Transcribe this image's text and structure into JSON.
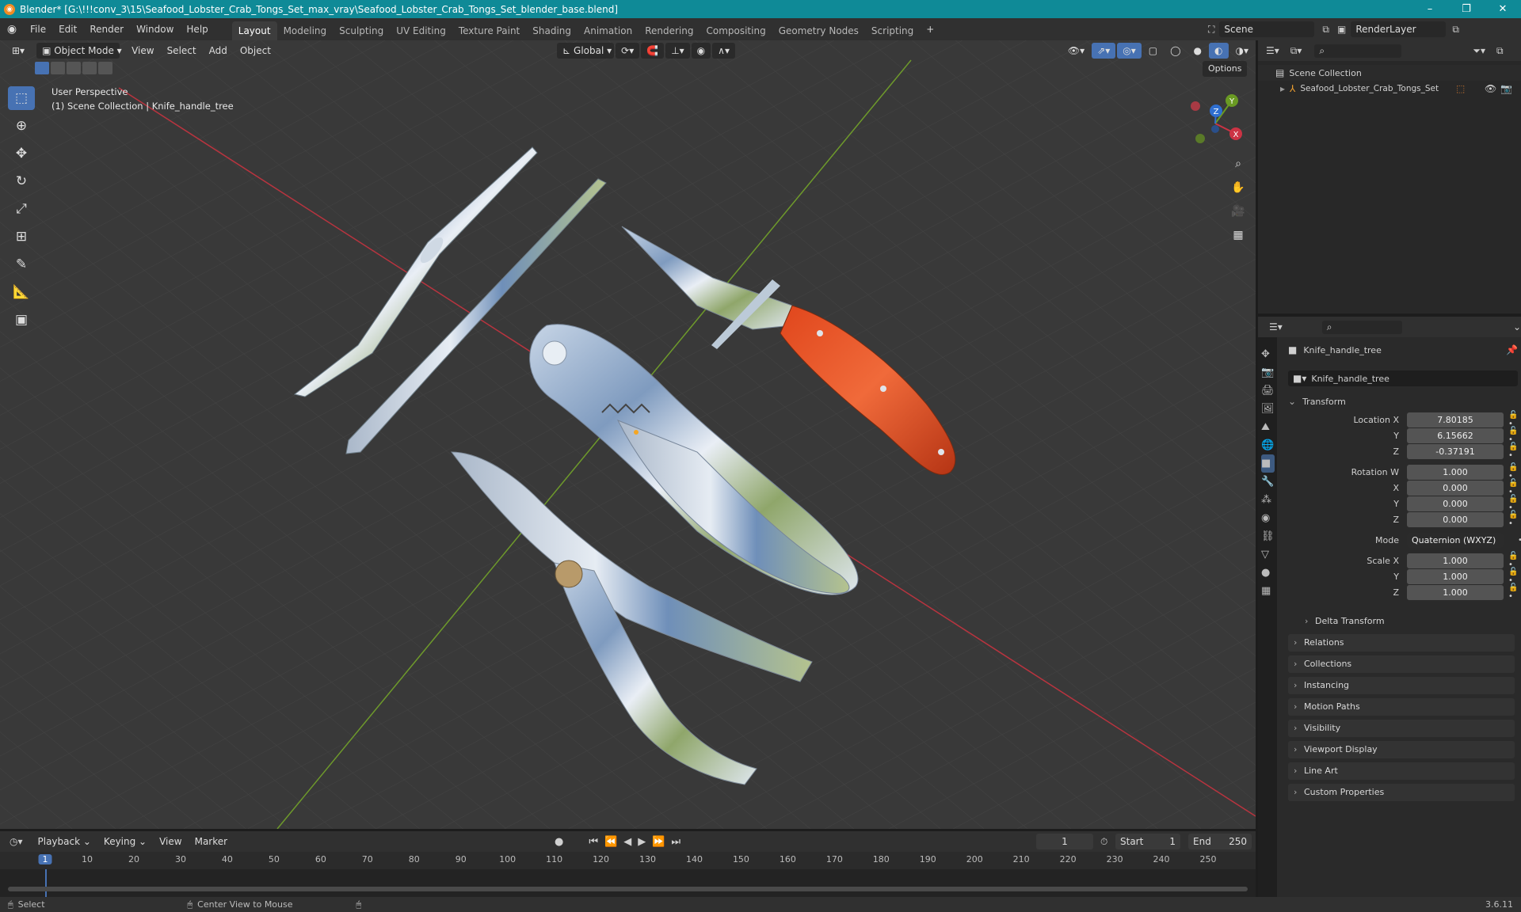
{
  "window": {
    "title": "Blender* [G:\\!!!conv_3\\15\\Seafood_Lobster_Crab_Tongs_Set_max_vray\\Seafood_Lobster_Crab_Tongs_Set_blender_base.blend]",
    "minimize": "–",
    "restore": "❐",
    "close": "✕"
  },
  "menu": [
    "File",
    "Edit",
    "Render",
    "Window",
    "Help"
  ],
  "workspaces": [
    "Layout",
    "Modeling",
    "Sculpting",
    "UV Editing",
    "Texture Paint",
    "Shading",
    "Animation",
    "Rendering",
    "Compositing",
    "Geometry Nodes",
    "Scripting"
  ],
  "add_workspace": "+",
  "scene": {
    "label": "Scene",
    "render_layer": "RenderLayer"
  },
  "viewport_header": {
    "mode": "Object Mode",
    "menus": [
      "View",
      "Select",
      "Add",
      "Object"
    ],
    "transform_orientation": "Global",
    "options": "Options"
  },
  "viewport": {
    "perspective": "User Perspective",
    "collection": "(1) Scene Collection | Knife_handle_tree"
  },
  "gizmo": {
    "x": "X",
    "y": "Y",
    "z": "Z"
  },
  "outliner": {
    "root": "Scene Collection",
    "item": "Seafood_Lobster_Crab_Tongs_Set"
  },
  "properties": {
    "object_name": "Knife_handle_tree",
    "data_name": "Knife_handle_tree",
    "transform_label": "Transform",
    "location": {
      "label": "Location X",
      "x": "7.80185",
      "y_label": "Y",
      "y": "6.15662",
      "z_label": "Z",
      "z": "-0.37191"
    },
    "rotation": {
      "label": "Rotation W",
      "w": "1.000",
      "x_label": "X",
      "x": "0.000",
      "y_label": "Y",
      "y": "0.000",
      "z_label": "Z",
      "z": "0.000"
    },
    "mode_label": "Mode",
    "mode": "Quaternion (WXYZ)",
    "scale": {
      "label": "Scale X",
      "x": "1.000",
      "y_label": "Y",
      "y": "1.000",
      "z_label": "Z",
      "z": "1.000"
    },
    "panels": [
      "Delta Transform",
      "Relations",
      "Collections",
      "Instancing",
      "Motion Paths",
      "Visibility",
      "Viewport Display",
      "Line Art",
      "Custom Properties"
    ]
  },
  "timeline": {
    "menus": [
      "Playback",
      "Keying",
      "View",
      "Marker"
    ],
    "current_frame": "1",
    "start_label": "Start",
    "start": "1",
    "end_label": "End",
    "end": "250",
    "ticks": [
      "1",
      "10",
      "20",
      "30",
      "40",
      "50",
      "60",
      "70",
      "80",
      "90",
      "100",
      "110",
      "120",
      "130",
      "140",
      "150",
      "160",
      "170",
      "180",
      "190",
      "200",
      "210",
      "220",
      "230",
      "240",
      "250"
    ]
  },
  "status": {
    "select": "Select",
    "center": "Center View to Mouse",
    "version": "3.6.11"
  },
  "colors": {
    "accent": "#4772b3",
    "titlebar": "#0f8a97",
    "axis_x": "#cc3344",
    "axis_y": "#6a9a23"
  }
}
